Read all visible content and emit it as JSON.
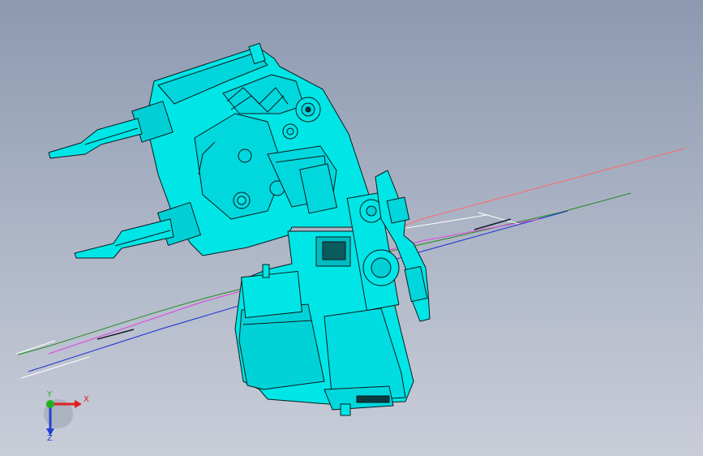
{
  "viewport": {
    "background_top": "#8c99b0",
    "background_bottom": "#c9cdd8"
  },
  "model": {
    "fill_color": "#00e6e6",
    "shade_color": "#00c2c8",
    "edge_color": "#0b1a1c"
  },
  "sketch_curves": {
    "colors": [
      "#ff6a6a",
      "#1f8a1f",
      "#1a2fd0",
      "#e040e0",
      "#ffffff"
    ]
  },
  "triad": {
    "x_label": "X",
    "y_label": "Y",
    "z_label": "Z",
    "x_color": "#e02020",
    "y_color": "#20b020",
    "z_color": "#2040d0"
  }
}
